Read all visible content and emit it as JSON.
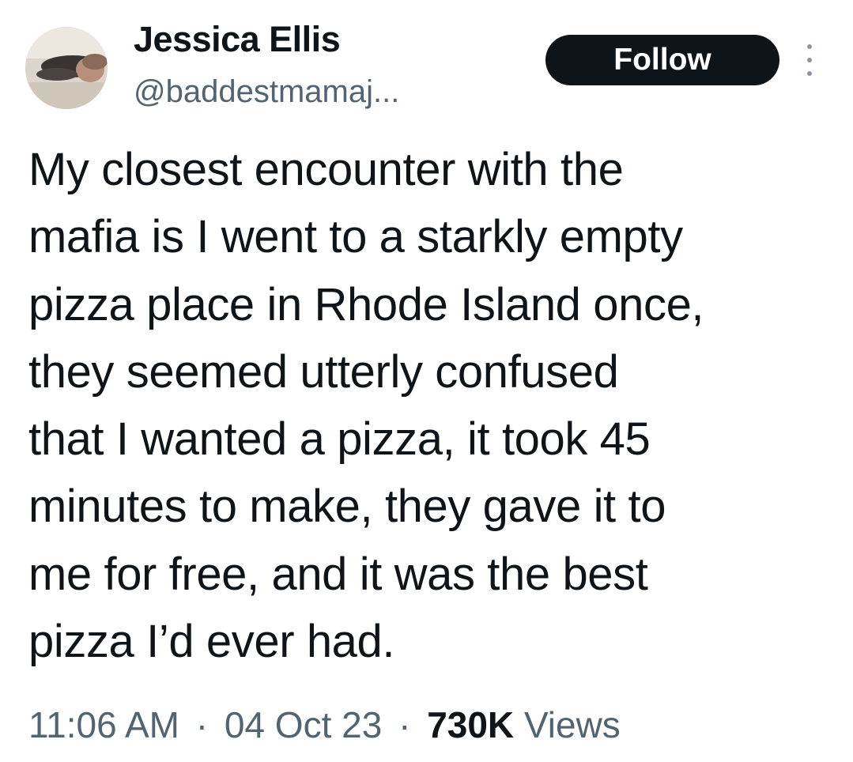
{
  "author": {
    "display_name": "Jessica Ellis",
    "handle": "@baddestmamaj..."
  },
  "actions": {
    "follow_label": "Follow",
    "more_icon": "more-vertical-icon"
  },
  "tweet": {
    "lines": [
      "My closest encounter with the",
      "mafia is I went to a starkly empty",
      "pizza place in Rhode Island once,",
      "they seemed utterly confused",
      "that I wanted a pizza, it took 45",
      "minutes to make, they gave it to",
      "me for free, and it was the best",
      "pizza I’d ever had."
    ]
  },
  "meta": {
    "time": "11:06 AM",
    "separator": "·",
    "date": "04 Oct 23",
    "views_count": "730K",
    "views_label": "Views"
  },
  "colors": {
    "text_primary": "#0f1419",
    "text_secondary": "#536471",
    "button_bg": "#0f1419",
    "button_text": "#ffffff",
    "background": "#ffffff"
  }
}
